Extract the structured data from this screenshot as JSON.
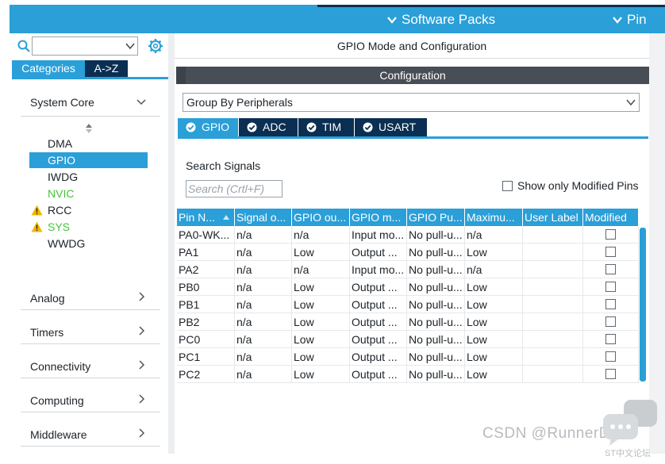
{
  "topbar": {
    "software_packs": "Software Packs",
    "pinout": "Pin"
  },
  "left": {
    "search": {
      "value": "",
      "placeholder": ""
    },
    "tabs": {
      "categories": "Categories",
      "az": "A->Z"
    },
    "categories": [
      {
        "label": "System Core",
        "expanded": true
      },
      {
        "label": "Analog"
      },
      {
        "label": "Timers"
      },
      {
        "label": "Connectivity"
      },
      {
        "label": "Computing"
      },
      {
        "label": "Middleware"
      }
    ],
    "peripherals": [
      {
        "label": "DMA",
        "state": "normal"
      },
      {
        "label": "GPIO",
        "state": "selected"
      },
      {
        "label": "IWDG",
        "state": "normal"
      },
      {
        "label": "NVIC",
        "state": "green"
      },
      {
        "label": "RCC",
        "state": "warning"
      },
      {
        "label": "SYS",
        "state": "warning-green"
      },
      {
        "label": "WWDG",
        "state": "normal"
      }
    ]
  },
  "right": {
    "title": "GPIO Mode and Configuration",
    "config_bar": "Configuration",
    "group_by": "Group By Peripherals",
    "ptabs": [
      "GPIO",
      "ADC",
      "TIM",
      "USART"
    ],
    "search_signals_label": "Search Signals",
    "search_signals_placeholder": "Search (Crtl+F)",
    "show_only_modified": "Show only Modified Pins",
    "columns": [
      "Pin N...",
      "Signal o...",
      "GPIO ou...",
      "GPIO m...",
      "GPIO Pu...",
      "Maximu...",
      "User Label",
      "Modified"
    ],
    "rows": [
      [
        "PA0-WK...",
        "n/a",
        "n/a",
        "Input mo...",
        "No pull-u...",
        "n/a",
        "",
        ""
      ],
      [
        "PA1",
        "n/a",
        "Low",
        "Output ...",
        "No pull-u...",
        "Low",
        "",
        ""
      ],
      [
        "PA2",
        "n/a",
        "n/a",
        "Input mo...",
        "No pull-u...",
        "n/a",
        "",
        ""
      ],
      [
        "PB0",
        "n/a",
        "Low",
        "Output ...",
        "No pull-u...",
        "Low",
        "",
        ""
      ],
      [
        "PB1",
        "n/a",
        "Low",
        "Output ...",
        "No pull-u...",
        "Low",
        "",
        ""
      ],
      [
        "PB2",
        "n/a",
        "Low",
        "Output ...",
        "No pull-u...",
        "Low",
        "",
        ""
      ],
      [
        "PC0",
        "n/a",
        "Low",
        "Output ...",
        "No pull-u...",
        "Low",
        "",
        ""
      ],
      [
        "PC1",
        "n/a",
        "Low",
        "Output ...",
        "No pull-u...",
        "Low",
        "",
        ""
      ],
      [
        "PC2",
        "n/a",
        "Low",
        "Output ...",
        "No pull-u...",
        "Low",
        "",
        ""
      ]
    ]
  },
  "watermark": {
    "text": "CSDN @RunnerDUT",
    "sub": "ST中文论坛"
  },
  "colors": {
    "accent": "#2a9fd8",
    "dark": "#0b2f52",
    "green": "#47c23c",
    "warning": "#f2b705"
  }
}
